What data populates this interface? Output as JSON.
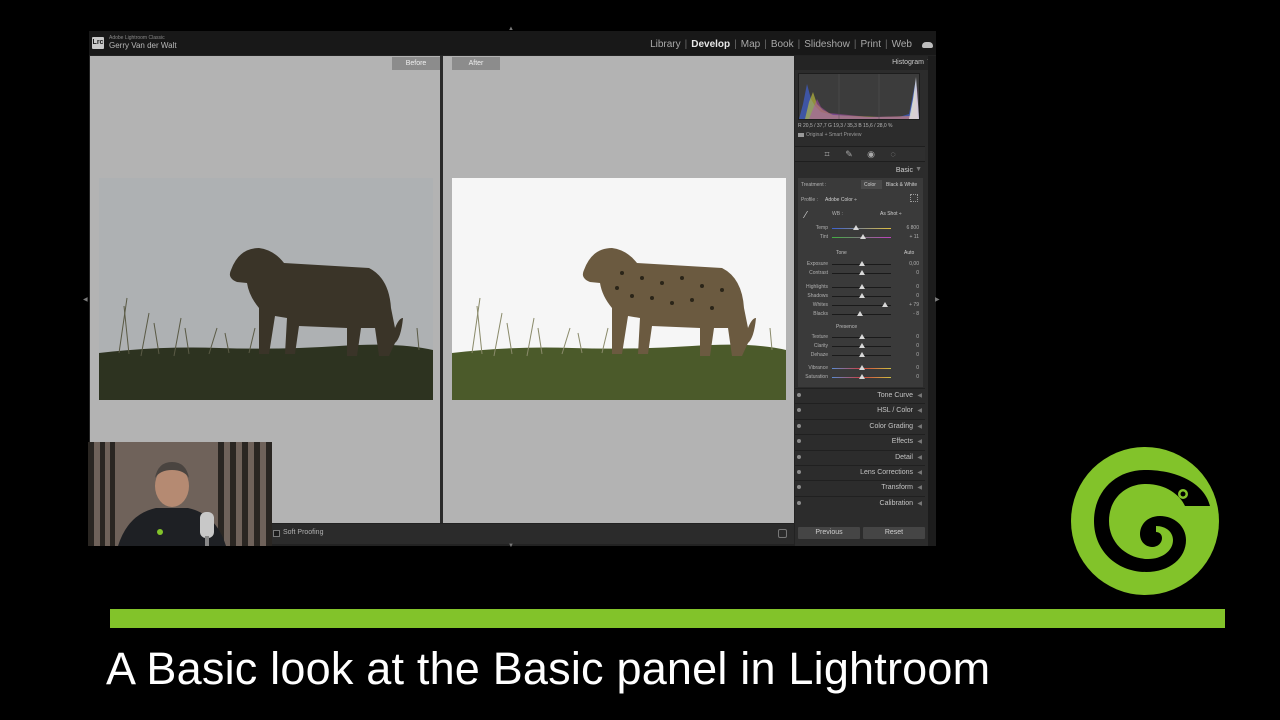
{
  "app": {
    "name": "Adobe Lightroom Classic",
    "user": "Gerry Van der Walt",
    "logo_text": "Lrc"
  },
  "modules": [
    {
      "label": "Library",
      "active": false
    },
    {
      "label": "Develop",
      "active": true
    },
    {
      "label": "Map",
      "active": false
    },
    {
      "label": "Book",
      "active": false
    },
    {
      "label": "Slideshow",
      "active": false
    },
    {
      "label": "Print",
      "active": false
    },
    {
      "label": "Web",
      "active": false
    }
  ],
  "module_separator": "|",
  "compare": {
    "before_label": "Before",
    "after_label": "After"
  },
  "toolbar": {
    "soft_proofing_label": "Soft Proofing"
  },
  "histogram": {
    "title": "Histogram",
    "collapse_glyph": "▼",
    "readout": "R  20,5 / 37,7  G  19,3 / 35,3  B  15,6 / 28,0  %",
    "preview_status": "Original + Smart Preview"
  },
  "basic": {
    "title": "Basic",
    "treatment_label": "Treatment :",
    "treatment_color": "Color",
    "treatment_bw": "Black & White",
    "profile_label": "Profile :",
    "profile_value": "Adobe Color ÷",
    "wb_label": "WB :",
    "wb_value": "As Shot ÷",
    "temp_label": "Temp",
    "temp_value": "6 800",
    "tint_label": "Tint",
    "tint_value": "+ 11",
    "tone_label": "Tone",
    "auto_label": "Auto",
    "presence_label": "Presence",
    "sliders": [
      {
        "label": "Exposure",
        "value": "0,00",
        "pos": 0.5
      },
      {
        "label": "Contrast",
        "value": "0",
        "pos": 0.5
      },
      {
        "label": "Highlights",
        "value": "0",
        "pos": 0.5
      },
      {
        "label": "Shadows",
        "value": "0",
        "pos": 0.5
      },
      {
        "label": "Whites",
        "value": "+ 79",
        "pos": 0.89
      },
      {
        "label": "Blacks",
        "value": "- 8",
        "pos": 0.48
      }
    ],
    "presence_sliders": [
      {
        "label": "Texture",
        "value": "0",
        "pos": 0.5
      },
      {
        "label": "Clarity",
        "value": "0",
        "pos": 0.5
      },
      {
        "label": "Dehaze",
        "value": "0",
        "pos": 0.5
      },
      {
        "label": "Vibrance",
        "value": "0",
        "pos": 0.5
      },
      {
        "label": "Saturation",
        "value": "0",
        "pos": 0.5
      }
    ]
  },
  "panels": [
    "Tone Curve",
    "HSL / Color",
    "Color Grading",
    "Effects",
    "Detail",
    "Lens Corrections",
    "Transform",
    "Calibration"
  ],
  "buttons": {
    "previous": "Previous",
    "reset": "Reset"
  },
  "caption": {
    "text": "A Basic look at the Basic panel in Lightroom"
  },
  "colors": {
    "accent_green": "#82c32a",
    "panel_bg": "#2c2c2c",
    "compare_bg": "#b3b3b3"
  }
}
